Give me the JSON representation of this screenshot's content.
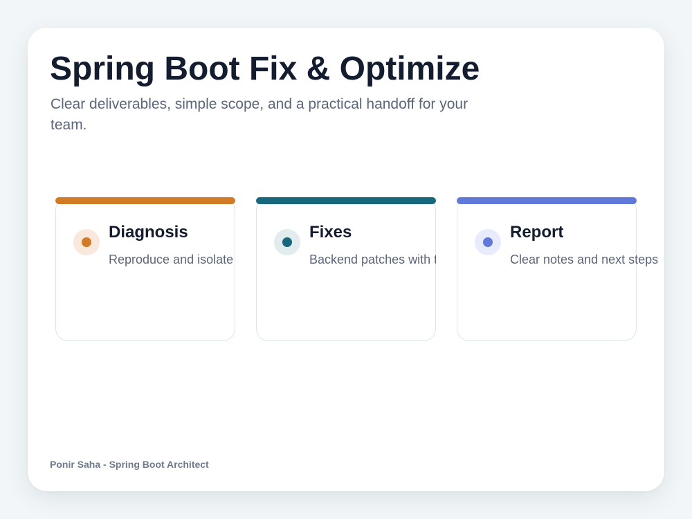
{
  "header": {
    "title": "Spring Boot Fix & Optimize",
    "subtitle": "Clear deliverables, simple scope, and a practical handoff for your team."
  },
  "cards": [
    {
      "title": "Diagnosis",
      "description": "Reproduce and isolate issues",
      "accent_color": "#d27a25",
      "icon_bg_color": "#fbe8dc",
      "icon": "dot-icon"
    },
    {
      "title": "Fixes",
      "description": "Backend patches with tests",
      "accent_color": "#17687c",
      "icon_bg_color": "#e2ecee",
      "icon": "dot-icon"
    },
    {
      "title": "Report",
      "description": "Clear notes and next steps",
      "accent_color": "#6079d8",
      "icon_bg_color": "#e7ebfb",
      "icon": "dot-icon"
    }
  ],
  "footer": {
    "author": "Ponir Saha - Spring Boot Architect"
  }
}
